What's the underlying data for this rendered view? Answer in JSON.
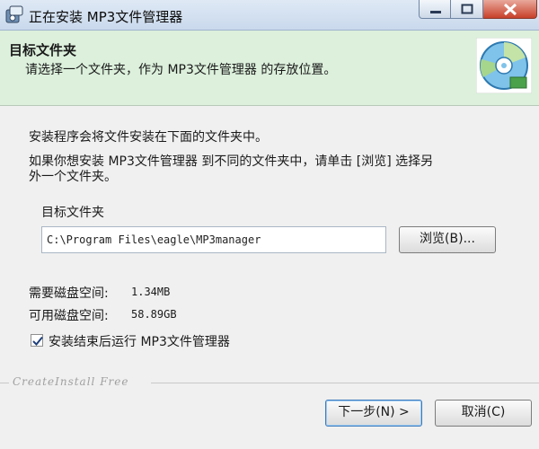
{
  "window": {
    "title": "正在安装 MP3文件管理器"
  },
  "header": {
    "title": "目标文件夹",
    "subtitle": "请选择一个文件夹，作为 MP3文件管理器 的存放位置。"
  },
  "body": {
    "line1": "安装程序会将文件安装在下面的文件夹中。",
    "line2a": "如果你想安装 MP3文件管理器 到不同的文件夹中，请单击 [浏览] 选择另",
    "line2b": "外一个文件夹。"
  },
  "destination": {
    "group_label": "目标文件夹",
    "path": "C:\\Program Files\\eagle\\MP3manager",
    "browse_label": "浏览(B)..."
  },
  "disk": {
    "required_label": "需要磁盘空间:",
    "required_value": "1.34MB",
    "available_label": "可用磁盘空间:",
    "available_value": "58.89GB"
  },
  "option": {
    "run_after_label": "安装结束后运行 MP3文件管理器",
    "checked": true
  },
  "footer": {
    "brand": "CreateInstall Free",
    "next_label": "下一步(N) >",
    "cancel_label": "取消(C)"
  }
}
